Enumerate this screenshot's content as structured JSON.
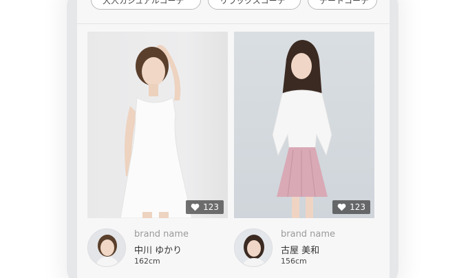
{
  "chips": [
    {
      "label": "大人カジュアルコーデ"
    },
    {
      "label": "リラックスコーデ"
    },
    {
      "label": "デートコーデ"
    }
  ],
  "cards": [
    {
      "likes": "123",
      "brand": "brand name",
      "name": "中川 ゆかり",
      "height": "162cm",
      "icon": "heart-icon"
    },
    {
      "likes": "123",
      "brand": "brand name",
      "name": "古屋 美和",
      "height": "156cm",
      "icon": "heart-icon"
    }
  ],
  "colors": {
    "background": "#f7f7f8",
    "badge": "#3c3c3c",
    "chip_border": "#b9b9b9"
  }
}
